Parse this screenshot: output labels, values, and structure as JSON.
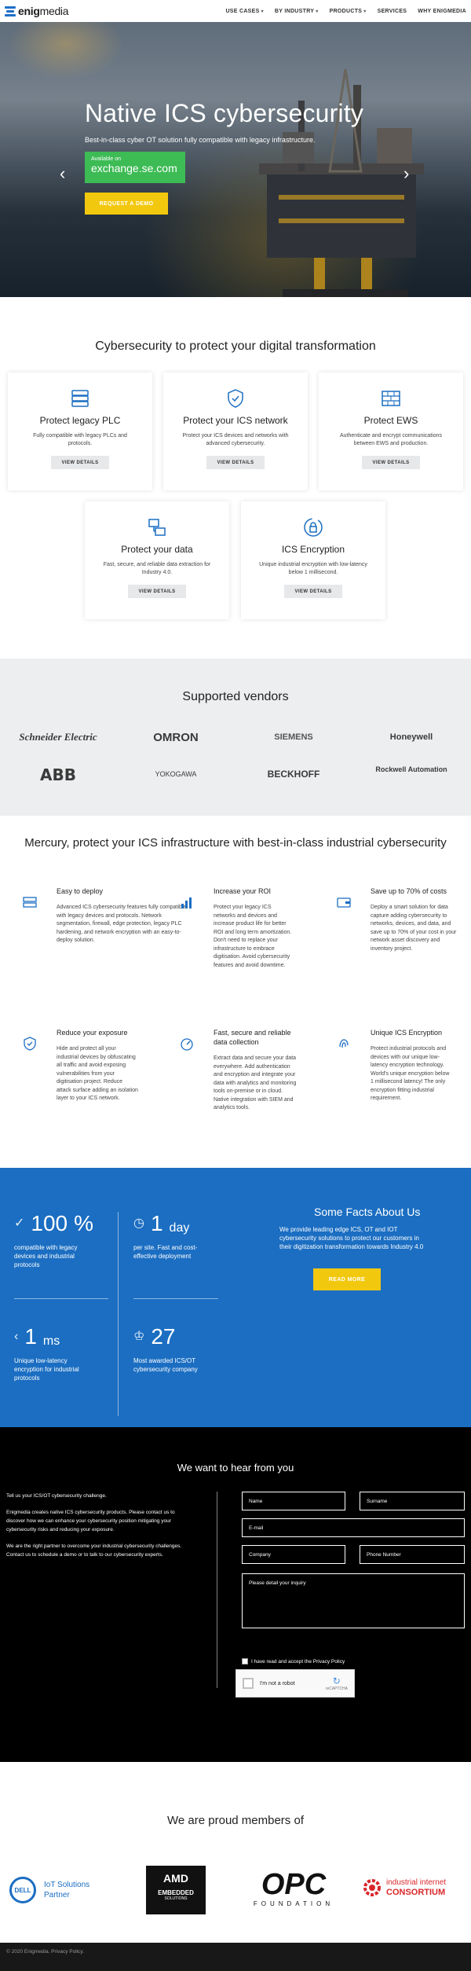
{
  "nav": {
    "brand_bold": "enig",
    "brand_rest": "media",
    "items": [
      "USE CASES",
      "BY INDUSTRY",
      "PRODUCTS",
      "SERVICES",
      "WHY ENIGMEDIA"
    ]
  },
  "hero": {
    "title": "Native ICS cybersecurity",
    "subtitle": "Best-in-class cyber OT solution fully compatible with legacy infrastructure.",
    "exchange_small": "Available on",
    "exchange_big": "exchange.se.com",
    "demo_button": "REQUEST A DEMO",
    "slides": 4,
    "active_slide": 1
  },
  "cyber": {
    "title": "Cybersecurity to protect your digital transformation",
    "cards": [
      {
        "icon": "server-stack-icon",
        "title": "Protect legacy PLC",
        "desc": "Fully compatible with legacy PLCs and protocols.",
        "button": "VIEW DETAILS"
      },
      {
        "icon": "shield-check-icon",
        "title": "Protect your ICS network",
        "desc": "Protect your ICS devices and networks with advanced cybersecurity.",
        "button": "VIEW DETAILS"
      },
      {
        "icon": "firewall-icon",
        "title": "Protect EWS",
        "desc": "Authenticate and encrypt communications between EWS and production.",
        "button": "VIEW DETAILS"
      },
      {
        "icon": "data-network-icon",
        "title": "Protect your data",
        "desc": "Fast, secure, and reliable data extraction for Industry 4.0.",
        "button": "VIEW DETAILS"
      },
      {
        "icon": "encryption-lock-icon",
        "title": "ICS Encryption",
        "desc": "Unique industrial encryption with low-latency below 1 millisecond.",
        "button": "VIEW DETAILS"
      }
    ]
  },
  "vendors": {
    "title": "Supported vendors",
    "list": [
      "Schneider Electric",
      "OMRON",
      "SIEMENS",
      "Honeywell",
      "ABB",
      "YOKOGAWA",
      "BECKHOFF",
      "Rockwell Automation"
    ]
  },
  "mercury": {
    "title": "Mercury, protect your ICS infrastructure with best-in-class industrial cybersecurity",
    "features": [
      {
        "icon": "server-icon",
        "title": "Easy to deploy",
        "desc": "Advanced ICS cybersecurity features fully compatible with legacy devices and protocols. Network segmentation, firewall, edge protection, legacy PLC hardening, and network encryption with an easy-to-deploy solution."
      },
      {
        "icon": "bar-chart-icon",
        "title": "Increase your ROI",
        "desc": "Protect your legacy ICS networks and devices and increase product life for better ROI and long term amortization. Don't need to replace your infrastructure to embrace digitisation. Avoid cybersecurity features and avoid downtime."
      },
      {
        "icon": "wallet-icon",
        "title": "Save up to 70% of costs",
        "desc": "Deploy a smart solution for data capture adding cybersecurity to networks, devices, and data, and save up to 70% of your cost in your network asset discovery and inventory project."
      },
      {
        "icon": "shield-icon",
        "title": "Reduce your exposure",
        "desc": "Hide and protect all your industrial devices by obfuscating all traffic and avoid exposing vulnerabilities from your digitisation project. Reduce attack surface adding an isolation layer to your ICS network."
      },
      {
        "icon": "speedometer-icon",
        "title": "Fast, secure and reliable data collection",
        "desc": "Extract data and secure your data everywhere. Add authentication and encryption and integrate your data with analytics and monitoring tools on-premise or in cloud. Native integration with SIEM and analytics tools."
      },
      {
        "icon": "fingerprint-icon",
        "title": "Unique ICS Encryption",
        "desc": "Protect industrial protocols and devices with our unique low-latency encryption technology. World's unique encryption below 1 millisecond latency! The only encryption fitting industrial requirement."
      }
    ]
  },
  "facts": {
    "title": "Some Facts About Us",
    "body": "We provide leading edge ICS, OT and IOT cybersecurity solutions to protect our customers in their digitization transformation towards Industry 4.0",
    "button": "READ MORE",
    "items": [
      {
        "glyph": "✓",
        "value": "100",
        "unit": "%",
        "text": "compatible with legacy devices and industrial protocols"
      },
      {
        "glyph": "◷",
        "value": "1",
        "unit": "day",
        "text": "per site. Fast and cost-effective deployment"
      },
      {
        "glyph": "‹",
        "value": "1",
        "unit": "ms",
        "text": "Unique low-latency encryption for industrial protocols"
      },
      {
        "glyph": "♔",
        "value": "27",
        "unit": "",
        "text": "Most awarded ICS/OT cybersecurity company"
      }
    ]
  },
  "contact": {
    "title": "We want to hear from you",
    "paragraphs": [
      "Tell us your ICS/OT cybersecurity challenge.",
      "Enigmedia creates native ICS cybersecurity products. Please contact us to discover how we can enhance your cybersecurity position mitigating your cybersecurity risks and reducing your exposure.",
      "We are the right partner to overcome your industrial cybersecurity challenges. Contact us to schedule a demo or to talk to our cybersecurity experts."
    ],
    "fields": {
      "name": "Name",
      "surname": "Surname",
      "email": "E-mail",
      "company": "Company",
      "phone": "Phone Number",
      "inquiry": "Please detail your inquiry"
    },
    "consent": "I have read and accept the Privacy Policy",
    "recaptcha": "I'm not a robot",
    "recaptcha_brand": "reCAPTCHA"
  },
  "members": {
    "title": "We are proud members of",
    "dell_line1": "IoT Solutions",
    "dell_line2": "Partner",
    "dell_logo": "DELL",
    "amd_line1": "AMD",
    "amd_line2": "EMBEDDED",
    "amd_line3": "SOLUTIONS",
    "opc": "OPC",
    "opc_sub": "FOUNDATION",
    "iic_line1": "industrial internet",
    "iic_line2": "CONSORTIUM"
  },
  "footer": {
    "text": "© 2020 Enigmedia. Privacy Policy."
  }
}
